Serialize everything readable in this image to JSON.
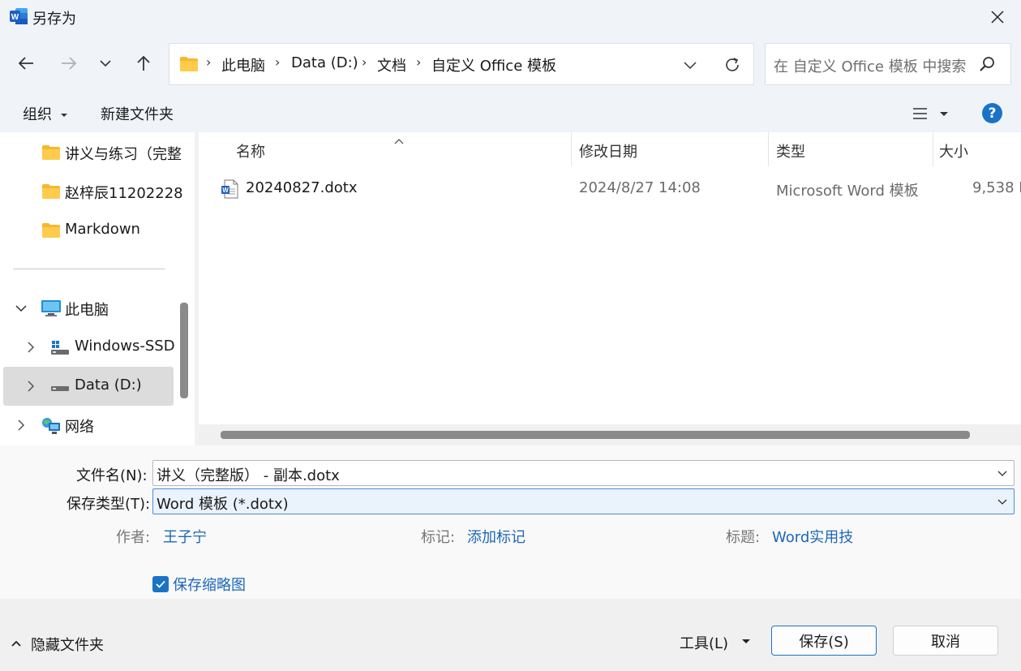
{
  "window": {
    "title": "另存为",
    "app_icon_letter": "W",
    "brand_color": "#1f5fbf"
  },
  "navigation": {
    "back_icon": "arrow-left-icon",
    "forward_icon": "arrow-right-icon",
    "recent_icon": "chevron-down-icon",
    "up_icon": "arrow-up-icon"
  },
  "address": {
    "crumbs": [
      "此电脑",
      "Data (D:)",
      "文档",
      "自定义 Office 模板"
    ]
  },
  "search": {
    "placeholder": "在 自定义 Office 模板 中搜索"
  },
  "toolbar": {
    "organize": "组织",
    "new_folder": "新建文件夹",
    "help": "?"
  },
  "sidebar": {
    "items": [
      {
        "label": "讲义与练习（完整"
      },
      {
        "label": "赵梓辰11202228"
      },
      {
        "label": "Markdown"
      },
      {
        "label": "此电脑"
      },
      {
        "label": "Windows-SSD"
      },
      {
        "label": "Data (D:)"
      },
      {
        "label": "网络"
      }
    ]
  },
  "file_list": {
    "columns": [
      "名称",
      "修改日期",
      "类型",
      "大小"
    ],
    "rows": [
      {
        "name": "20240827.dotx",
        "modified": "2024/8/27 14:08",
        "type": "Microsoft Word 模板",
        "size": "9,538 K"
      }
    ]
  },
  "form": {
    "filename_label": "文件名(N):",
    "filename_value": "讲义（完整版） - 副本.dotx",
    "filetype_label": "保存类型(T):",
    "filetype_value": "Word 模板 (*.dotx)",
    "author_label": "作者:",
    "author_value": "王子宁",
    "tags_label": "标记:",
    "tags_value": "添加标记",
    "title_label": "标题:",
    "title_value": "Word实用技",
    "thumbnail_label": "保存缩略图",
    "thumbnail_checked": true
  },
  "footer": {
    "hide_folders": "隐藏文件夹",
    "tools": "工具(L)",
    "save": "保存(S)",
    "cancel": "取消"
  }
}
